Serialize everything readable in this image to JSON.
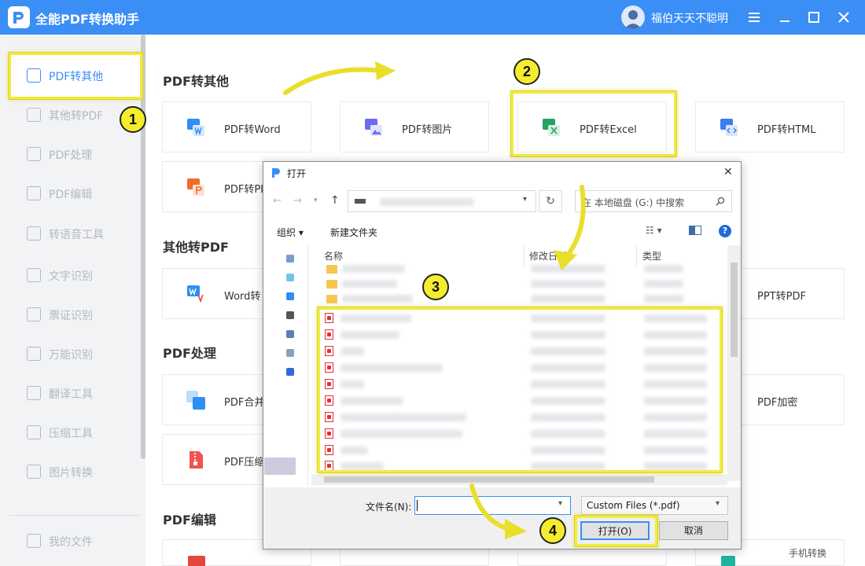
{
  "app": {
    "title": "全能PDF转换助手",
    "user_name": "福伯天天不聪明",
    "accent_color": "#3a8ef5",
    "highlight_color": "#f1ec3c"
  },
  "sidebar": {
    "items": [
      {
        "label": "PDF转其他",
        "icon": "pdf-convert-icon",
        "active": true
      },
      {
        "label": "其他转PDF",
        "icon": "to-pdf-icon"
      },
      {
        "label": "PDF处理",
        "icon": "pdf-process-icon"
      },
      {
        "label": "PDF编辑",
        "icon": "pdf-edit-icon"
      },
      {
        "label": "转语音工具",
        "icon": "voice-icon"
      },
      {
        "label": "文字识别",
        "icon": "ocr-icon"
      },
      {
        "label": "票证识别",
        "icon": "ticket-icon"
      },
      {
        "label": "万能识别",
        "icon": "scan-icon"
      },
      {
        "label": "翻译工具",
        "icon": "translate-icon"
      },
      {
        "label": "压缩工具",
        "icon": "compress-icon"
      },
      {
        "label": "图片转换",
        "icon": "image-icon"
      },
      {
        "label": "我的文件",
        "icon": "my-files-icon"
      }
    ]
  },
  "main": {
    "sections": {
      "pdf_to_other": "PDF转其他",
      "other_to_pdf": "其他转PDF",
      "pdf_process": "PDF处理",
      "pdf_edit": "PDF编辑"
    },
    "cards": {
      "pdf_word": "PDF转Word",
      "pdf_image": "PDF转图片",
      "pdf_excel": "PDF转Excel",
      "pdf_html": "PDF转HTML",
      "pdf_ppt": "PDF转PI",
      "word_pdf": "Word转",
      "ppt_pdf": "PPT转PDF",
      "pdf_merge": "PDF合并",
      "pdf_encrypt": "PDF加密",
      "pdf_compress": "PDF压缩"
    },
    "phone_convert": "手机转换"
  },
  "steps": [
    "1",
    "2",
    "3",
    "4"
  ],
  "dialog": {
    "title": "打开",
    "search_placeholder": "在 本地磁盘 (G:) 中搜索",
    "organize": "组织",
    "new_folder": "新建文件夹",
    "col_name": "名称",
    "col_modified": "修改日期",
    "col_type": "类型",
    "filename_label": "文件名(N):",
    "filter": "Custom Files (*.pdf)",
    "open_button": "打开(O)",
    "cancel_button": "取消"
  }
}
